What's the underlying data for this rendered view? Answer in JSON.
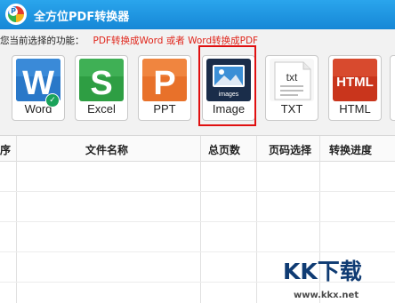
{
  "app": {
    "title": "全方位PDF转换器",
    "logo_letter": "P"
  },
  "function_line": {
    "label": "您当前选择的功能：",
    "value": "PDF转换成Word 或者 Word转换成PDF"
  },
  "formats": [
    {
      "label": "Word",
      "glyph": "W",
      "color": "#2a78c8",
      "icon": "word-icon",
      "checked": true
    },
    {
      "label": "Excel",
      "glyph": "S",
      "color": "#2e9e43",
      "icon": "excel-icon"
    },
    {
      "label": "PPT",
      "glyph": "P",
      "color": "#e8712a",
      "icon": "ppt-icon"
    },
    {
      "label": "Image",
      "glyph": "images",
      "color": "#1a2d4a",
      "icon": "image-icon",
      "selected": true
    },
    {
      "label": "TXT",
      "glyph": "txt",
      "color": "#e6e6e6",
      "icon": "txt-icon"
    },
    {
      "label": "HTML",
      "glyph": "HTML",
      "color": "#c9351c",
      "icon": "html-icon"
    }
  ],
  "table": {
    "columns": [
      "序",
      "文件名称",
      "总页数",
      "页码选择",
      "转换进度"
    ]
  },
  "watermark": {
    "text": "KK下载",
    "url": "www.kkx.net"
  }
}
